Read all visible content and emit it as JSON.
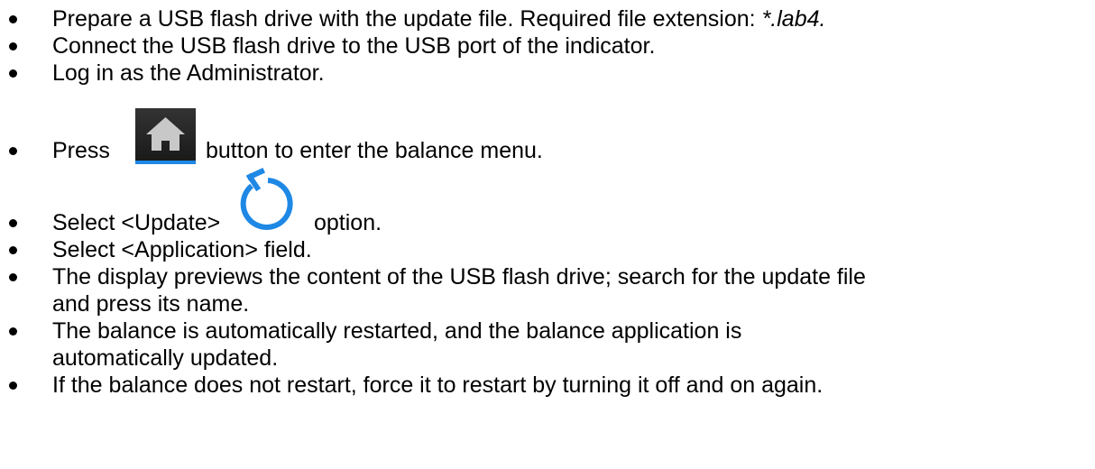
{
  "icons": {
    "home": "home-icon",
    "update": "refresh-circle-arrow-icon",
    "home_bg": "#2b2b2b",
    "home_accent": "#1e88e5",
    "update_color": "#1e88e5"
  },
  "steps": [
    {
      "text": "Prepare a USB flash drive with the update file. Required file extension: ",
      "ext": "*.lab4."
    },
    {
      "text": "Connect the USB flash drive to the USB port of the indicator."
    },
    {
      "text": "Log in as the Administrator."
    },
    {
      "before": "Press",
      "after": "button to enter the balance menu."
    },
    {
      "before": "Select <Update>",
      "after": "option."
    },
    {
      "text": "Select <Application> field."
    },
    {
      "line1": "The display previews the content of the USB flash drive; search for the update file",
      "line2": "and press its name."
    },
    {
      "line1": "The balance is automatically restarted, and the balance application is",
      "line2": "automatically updated."
    },
    {
      "text": "If the balance does not restart, force it to restart by turning it off and on again."
    }
  ]
}
